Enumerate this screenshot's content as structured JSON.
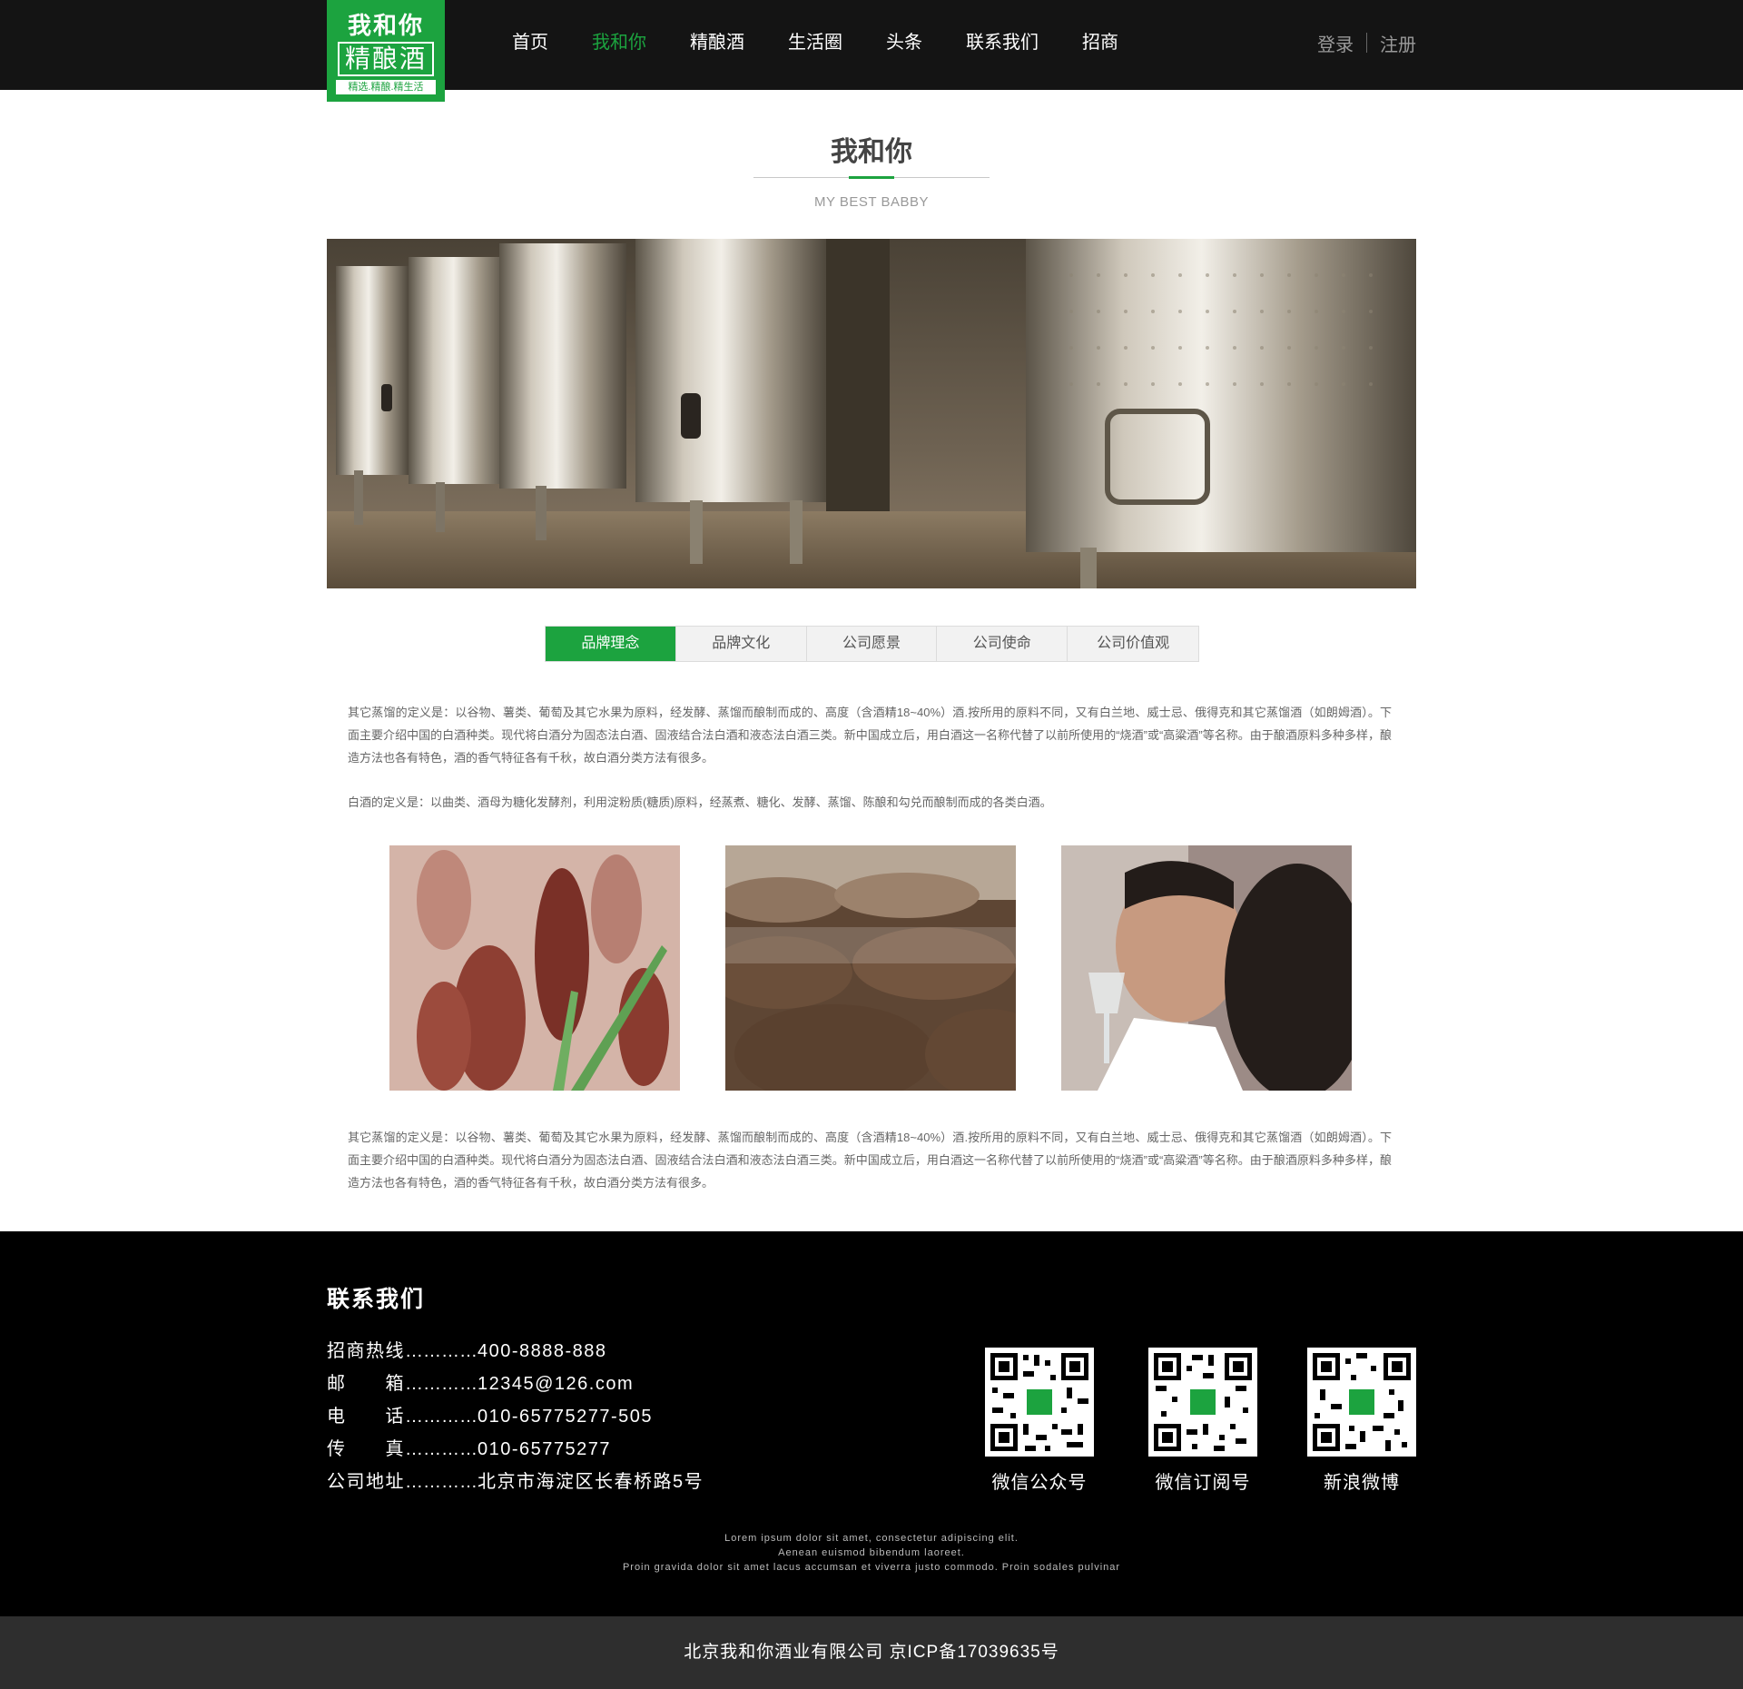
{
  "header": {
    "logo": {
      "line1": "我和你",
      "line2": "精酿酒",
      "slogan": "精选.精酿.精生活"
    },
    "nav": [
      {
        "label": "首页",
        "active": false
      },
      {
        "label": "我和你",
        "active": true
      },
      {
        "label": "精酿酒",
        "active": false
      },
      {
        "label": "生活圈",
        "active": false
      },
      {
        "label": "头条",
        "active": false
      },
      {
        "label": "联系我们",
        "active": false
      },
      {
        "label": "招商",
        "active": false
      }
    ],
    "login": "登录",
    "register": "注册"
  },
  "section": {
    "title": "我和你",
    "subtitle": "MY BEST BABBY"
  },
  "tabs": [
    {
      "label": "品牌理念",
      "active": true
    },
    {
      "label": "品牌文化",
      "active": false
    },
    {
      "label": "公司愿景",
      "active": false
    },
    {
      "label": "公司使命",
      "active": false
    },
    {
      "label": "公司价值观",
      "active": false
    }
  ],
  "content": {
    "para1": "其它蒸馏的定义是：以谷物、薯类、葡萄及其它水果为原料，经发酵、蒸馏而酿制而成的、高度（含酒精18~40%）酒.按所用的原料不同，又有白兰地、威士忌、俄得克和其它蒸馏酒（如朗姆酒）。下面主要介绍中国的白酒种类。现代将白酒分为固态法白酒、固液结合法白酒和液态法白酒三类。新中国成立后，用白酒这一名称代替了以前所使用的“烧酒”或“高粱酒”等名称。由于酿酒原料多种多样，酿造方法也各有特色，酒的香气特征各有千秋，故白酒分类方法有很多。",
    "para2": "白酒的定义是：以曲类、酒母为糖化发酵剂，利用淀粉质(糖质)原料，经蒸煮、糖化、发酵、蒸馏、陈酿和勾兑而酿制而成的各类白酒。",
    "para3": "其它蒸馏的定义是：以谷物、薯类、葡萄及其它水果为原料，经发酵、蒸馏而酿制而成的、高度（含酒精18~40%）酒.按所用的原料不同，又有白兰地、威士忌、俄得克和其它蒸馏酒（如朗姆酒）。下面主要介绍中国的白酒种类。现代将白酒分为固态法白酒、固液结合法白酒和液态法白酒三类。新中国成立后，用白酒这一名称代替了以前所使用的“烧酒”或“高粱酒”等名称。由于酿酒原料多种多样，酿造方法也各有特色，酒的香气特征各有千秋，故白酒分类方法有很多。"
  },
  "footer": {
    "title": "联系我们",
    "contacts": [
      {
        "label": "招商热线",
        "dots": "…………",
        "value": "400-8888-888"
      },
      {
        "label": "邮　　箱",
        "dots": "…………",
        "value": "12345@126.com"
      },
      {
        "label": "电　　话",
        "dots": "…………",
        "value": "010-65775277-505"
      },
      {
        "label": "传　　真",
        "dots": "…………",
        "value": "010-65775277"
      },
      {
        "label": "公司地址",
        "dots": "…………",
        "value": "北京市海淀区长春桥路5号"
      }
    ],
    "qrcodes": [
      {
        "label": "微信公众号"
      },
      {
        "label": "微信订阅号"
      },
      {
        "label": "新浪微博"
      }
    ],
    "lorem": [
      "Lorem ipsum dolor sit amet, consectetur adipiscing elit.",
      "Aenean euismod bibendum laoreet.",
      "Proin gravida dolor sit amet lacus accumsan et viverra justo commodo. Proin sodales pulvinar"
    ],
    "copyright": "北京我和你酒业有限公司 京ICP备17039635号"
  },
  "colors": {
    "accent": "#1ca33f",
    "header_bg": "#141414",
    "footer_bg": "#000000",
    "bottom_bar_bg": "#2e2e2e"
  }
}
